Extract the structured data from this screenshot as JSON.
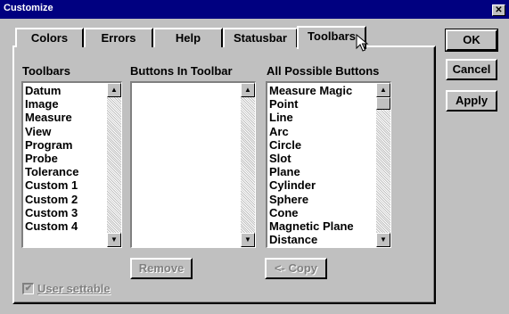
{
  "window": {
    "title": "Customize",
    "close_glyph": "✕"
  },
  "tabs": [
    {
      "label": "Colors"
    },
    {
      "label": "Errors"
    },
    {
      "label": "Help"
    },
    {
      "label": "Statusbar"
    },
    {
      "label": "Toolbars",
      "active": true
    }
  ],
  "toolbars_list": {
    "label": "Toolbars",
    "items": [
      "Datum",
      "Image",
      "Measure",
      "View",
      "Program",
      "Probe",
      "Tolerance",
      "Custom 1",
      "Custom 2",
      "Custom 3",
      "Custom 4"
    ]
  },
  "buttons_in_toolbar": {
    "label": "Buttons In Toolbar",
    "items": []
  },
  "all_buttons": {
    "label": "All Possible Buttons",
    "items": [
      "Measure Magic",
      "Point",
      "Line",
      "Arc",
      "Circle",
      "Slot",
      "Plane",
      "Cylinder",
      "Sphere",
      "Cone",
      "Magnetic Plane",
      "Distance"
    ]
  },
  "actions": {
    "remove": "Remove",
    "copy": "<- Copy"
  },
  "user_settable": {
    "label": "User settable",
    "checked": true
  },
  "dialog_buttons": {
    "ok": "OK",
    "cancel": "Cancel",
    "apply": "Apply"
  },
  "icons": {
    "scroll_up": "▲",
    "scroll_down": "▼",
    "check": "✔",
    "cursor": "arrow-cursor-icon"
  }
}
